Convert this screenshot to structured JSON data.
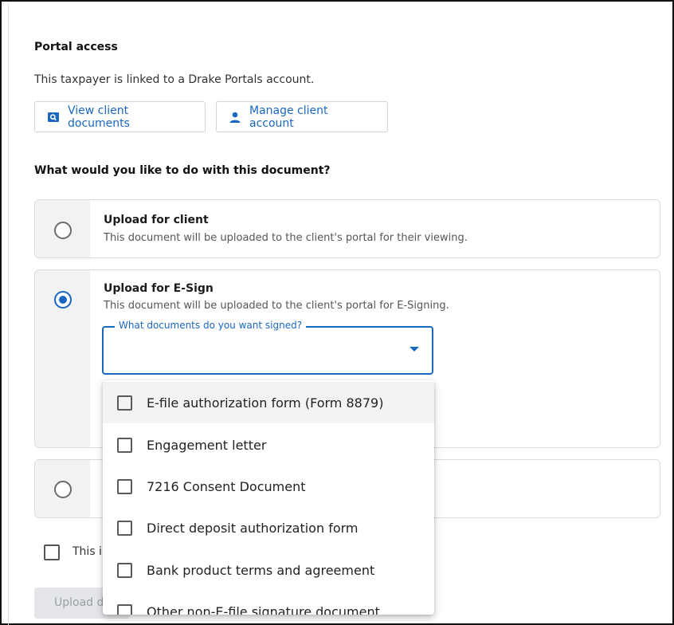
{
  "portal": {
    "title": "Portal access",
    "linked_text": "This taxpayer is linked to a Drake Portals account.",
    "view_docs_label": "View client documents",
    "manage_account_label": "Manage client account"
  },
  "question": "What would you like to do with this document?",
  "options": [
    {
      "title": "Upload for client",
      "desc": "This document will be uploaded to the client's portal for their viewing.",
      "selected": false
    },
    {
      "title": "Upload for E-Sign",
      "desc": "This document will be uploaded to the client's portal for E-Signing.",
      "selected": true
    },
    {
      "title": "",
      "desc": "",
      "selected": false
    }
  ],
  "esign_select": {
    "label": "What documents do you want signed?",
    "value": "",
    "items": [
      {
        "label": "E-file authorization form (Form 8879)",
        "checked": false
      },
      {
        "label": "Engagement letter",
        "checked": false
      },
      {
        "label": "7216 Consent Document",
        "checked": false
      },
      {
        "label": "Direct deposit authorization form",
        "checked": false
      },
      {
        "label": "Bank product terms and agreement",
        "checked": false
      },
      {
        "label": "Other non-E-file signature document",
        "checked": false
      }
    ]
  },
  "footer": {
    "checkbox_label": "This i",
    "upload_button_label": "Upload d"
  },
  "colors": {
    "accent": "#1a67c2",
    "disabled_bg": "#e4e6e9"
  }
}
